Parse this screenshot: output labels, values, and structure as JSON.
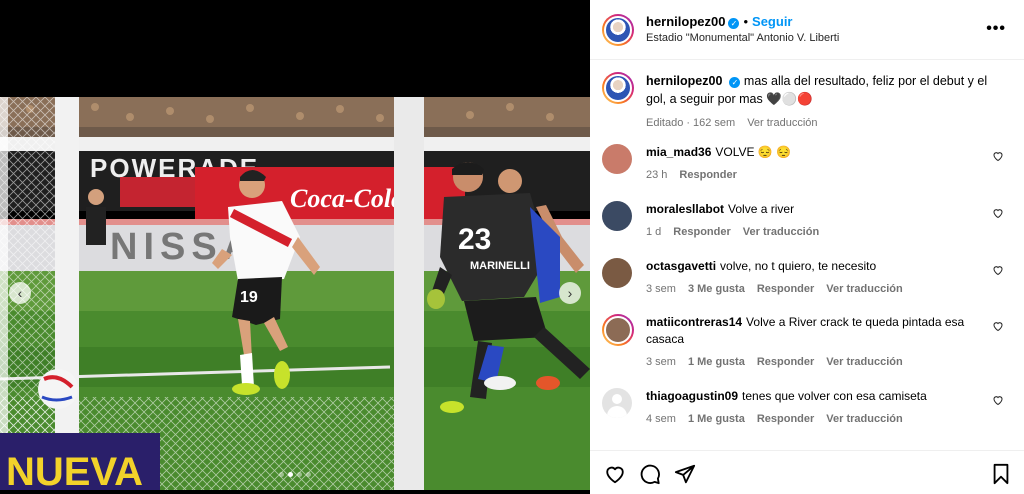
{
  "post": {
    "username": "hernilopez00",
    "verified_mark": "✓",
    "separator": "•",
    "follow_label": "Seguir",
    "location": "Estadio \"Monumental\" Antonio V. Liberti",
    "more_icon": "more-horizontal-icon"
  },
  "caption": {
    "username": "hernilopez00",
    "text": "mas alla del resultado, feliz por el debut y el gol, a seguir por mas",
    "emojis": "🖤⚪🔴",
    "meta_status": "Editado",
    "meta_time": "162 sem",
    "meta_translate": "Ver traducción"
  },
  "comments": [
    {
      "username": "mia_mad36",
      "text": "VOLVE 😔 😔",
      "time": "23 h",
      "likes": "",
      "reply": "Responder",
      "translate": "",
      "avatar_color": "#c97b6a"
    },
    {
      "username": "moralesllabot",
      "text": "Volve a river",
      "time": "1 d",
      "likes": "",
      "reply": "Responder",
      "translate": "Ver traducción",
      "avatar_color": "#3b4a63"
    },
    {
      "username": "octasgavetti",
      "text": "volve, no t quiero, te necesito",
      "time": "3 sem",
      "likes": "3 Me gusta",
      "reply": "Responder",
      "translate": "Ver traducción",
      "avatar_color": "#7a5a43"
    },
    {
      "username": "matiicontreras14",
      "text": "Volve a River crack te queda pintada esa casaca",
      "time": "3 sem",
      "likes": "1 Me gusta",
      "reply": "Responder",
      "translate": "Ver traducción",
      "avatar_color": "#8c6b55"
    },
    {
      "username": "thiagoagustin09",
      "text": "tenes que volver con esa camiseta",
      "time": "4 sem",
      "likes": "1 Me gusta",
      "reply": "Responder",
      "translate": "Ver traducción",
      "avatar_color": "#dbdbdb"
    }
  ],
  "carousel": {
    "slide_count": 4,
    "active_index": 1
  },
  "photo": {
    "jersey_number_keeper": "23",
    "keeper_name": "MARINELLI",
    "jersey_number_player": "19",
    "ad_text": "Coca-Cola",
    "banner_text": "NISSAN",
    "board_text": "NUEVA"
  },
  "colors": {
    "accent": "#0095f6",
    "meta": "#737373"
  }
}
